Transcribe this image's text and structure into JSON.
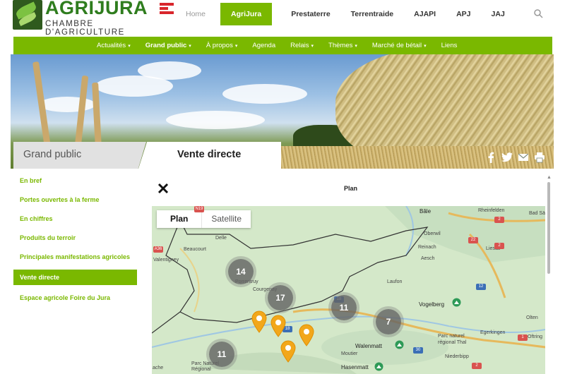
{
  "logo": {
    "name": "AGRIJURA",
    "subtitle": "CHAMBRE D'AGRICULTURE"
  },
  "top_nav": [
    "Home",
    "AgriJura",
    "Prestaterre",
    "Terrentraide",
    "AJAPI",
    "APJ",
    "JAJ"
  ],
  "top_nav_active": "AgriJura",
  "main_nav": [
    {
      "label": "Actualités",
      "dropdown": true
    },
    {
      "label": "Grand public",
      "dropdown": true
    },
    {
      "label": "À propos",
      "dropdown": true
    },
    {
      "label": "Agenda",
      "dropdown": false
    },
    {
      "label": "Relais",
      "dropdown": true
    },
    {
      "label": "Thèmes",
      "dropdown": true
    },
    {
      "label": "Marché de bétail",
      "dropdown": true
    },
    {
      "label": "Liens",
      "dropdown": false
    }
  ],
  "main_nav_caret": "▾",
  "breadcrumb": {
    "section": "Grand public",
    "page": "Vente directe"
  },
  "share_icons": [
    "facebook-icon",
    "twitter-icon",
    "mail-icon",
    "print-icon"
  ],
  "sidebar": [
    {
      "label": "En bref",
      "active": false
    },
    {
      "label": "Portes ouvertes à la ferme",
      "active": false
    },
    {
      "label": "En chiffres",
      "active": false
    },
    {
      "label": "Produits du terroir",
      "active": false
    },
    {
      "label": "Principales manifestations agricoles",
      "active": false
    },
    {
      "label": "Vente directe",
      "active": true
    },
    {
      "label": "Espace agricole Foire du Jura",
      "active": false
    }
  ],
  "content": {
    "title": "Plan"
  },
  "map": {
    "type_buttons": [
      "Plan",
      "Satellite"
    ],
    "selected_type": "Plan",
    "labels": [
      "Bâle",
      "Rheinfelden",
      "Bad Sä",
      "Oberwil",
      "Reinach",
      "Liestal",
      "Aesch",
      "Delle",
      "Beaucourt",
      "Valentigney",
      "Porrentruy",
      "Courgenay",
      "Laufon",
      "Vogelberg",
      "Olten",
      "Egerkingen",
      "Oftring",
      "Parc naturel régional Thal",
      "Walenmatt",
      "Moutier",
      "Niederbipp",
      "Hasenmatt",
      "Parc Naturel Régional",
      "ache"
    ],
    "route_badges": [
      "N19",
      "A36",
      "18",
      "22",
      "2",
      "2",
      "12",
      "30",
      "1",
      "2",
      "18"
    ],
    "clusters": [
      14,
      17,
      11,
      7,
      11
    ],
    "pins": 4,
    "accent_pin": "#f2a71b"
  },
  "colors": {
    "brand_green": "#7ab800",
    "dark_green": "#2f7d1e",
    "red": "#d8262c"
  }
}
